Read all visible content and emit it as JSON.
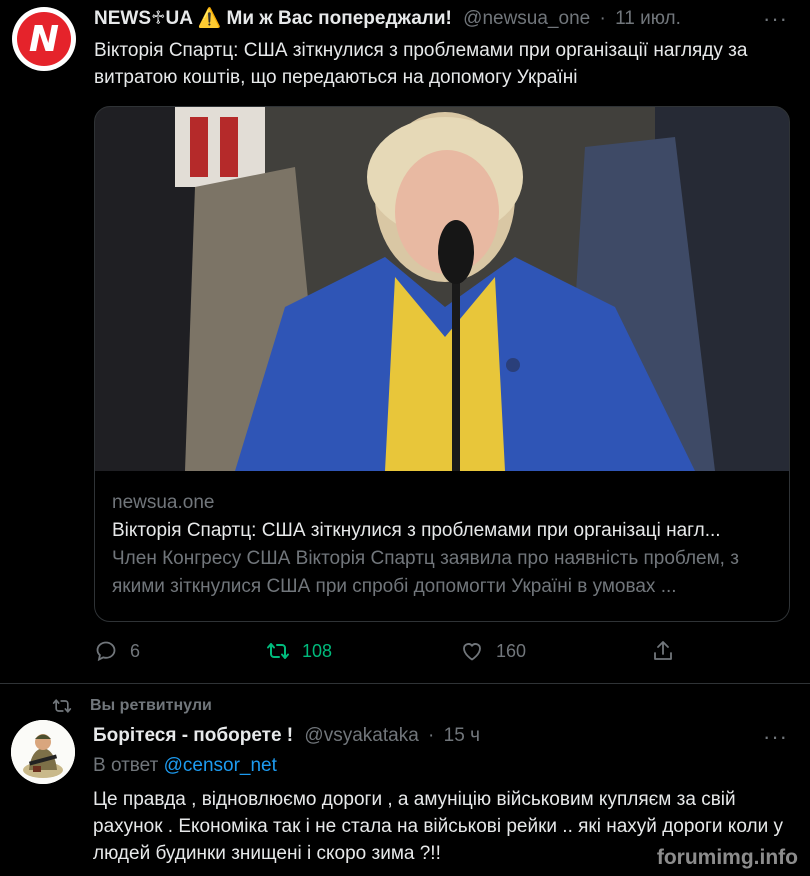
{
  "tweet1": {
    "name": "NEWS♱UA ⚠️ Ми ж Вас попереджали!",
    "handle": "@newsua_one",
    "time": "11 июл.",
    "text": "Вікторія Спартц: США зіткнулися з проблемами при організації нагляду за витратою коштів, що передаються на допомогу Україні",
    "avatar_letter": "N",
    "card": {
      "domain": "newsua.one",
      "title": "Вікторія Спартц: США зіткнулися з проблемами при організаці нагл...",
      "description": "Член Конгресу США Вікторія Спартц заявила про наявність проблем, з якими зіткнулися США при спробі допомогти Україні в умовах ..."
    },
    "actions": {
      "replies": "6",
      "retweets": "108",
      "likes": "160"
    }
  },
  "retweet_notice": "Вы ретвитнули",
  "tweet2": {
    "name": "Борітеся - поборете !",
    "handle": "@vsyakataka",
    "time": "15 ч",
    "reply_prefix": "В ответ",
    "reply_to": "@censor_net",
    "text": "Це правда , відновлюємо дороги , а амуніцію військовим купляєм за свій рахунок . Економіка так і не стала на військові рейки .. які нахуй дороги коли у людей будинки знищені і скоро зима ?!!"
  },
  "watermark": "forumimg.info",
  "colors": {
    "accent": "#1d9bf0",
    "retweet": "#00ba7c",
    "muted": "#71767b",
    "brand_red": "#e5232b"
  }
}
